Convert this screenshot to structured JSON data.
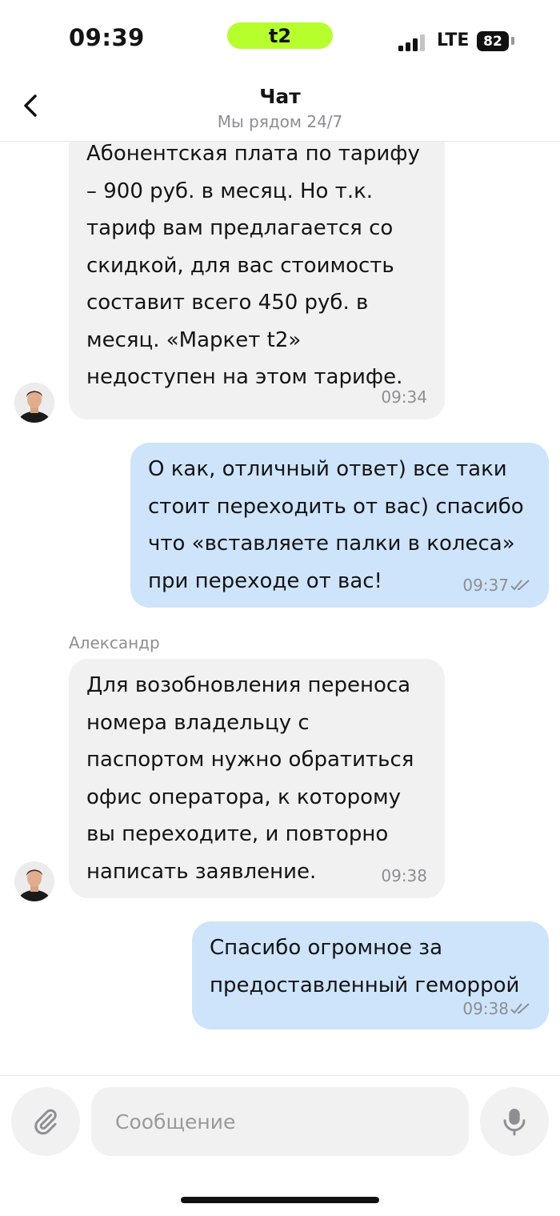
{
  "status_bar": {
    "time": "09:39",
    "carrier": "t2",
    "network": "LTE",
    "battery": "82"
  },
  "header": {
    "title": "Чат",
    "subtitle": "Мы рядом 24/7"
  },
  "messages": [
    {
      "direction": "incoming",
      "text": "Абонентская плата по тарифу\n– 900 руб. в месяц. Но т.к.\nтариф вам предлагается со\nскидкой, для вас стоимость\nсоставит всего 450 руб. в\nмесяц. «Маркет t2»\nнедоступен на этом тарифе.",
      "time": "09:34"
    },
    {
      "direction": "outgoing",
      "text": "О как, отличный ответ) все таки\nстоит переходить от вас) спасибо\nчто «вставляете палки в колеса»\nпри переходе от вас!",
      "time": "09:37"
    },
    {
      "direction": "incoming",
      "sender": "Александр",
      "text": "Для возобновления переноса\nномера владельцу с\nпаспортом нужно обратиться\nофис оператора, к которому\nвы переходите, и повторно\nнаписать заявление.",
      "time": "09:38"
    },
    {
      "direction": "outgoing",
      "text": "Спасибо огромное за\nпредоставленный геморрой",
      "time": "09:38"
    }
  ],
  "composer": {
    "placeholder": "Сообщение"
  },
  "colors": {
    "brand": "#b6ff2d",
    "incoming_bubble": "#f1f1f1",
    "outgoing_bubble": "#cde4fb"
  }
}
